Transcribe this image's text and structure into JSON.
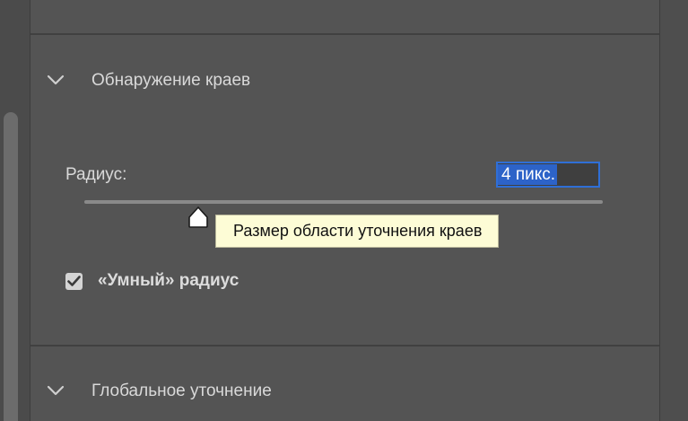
{
  "panel": {
    "sections": [
      {
        "title": "Обнаружение краев",
        "expanded": true,
        "chevron_icon": "chevron-down-icon"
      },
      {
        "title": "Глобальное уточнение",
        "expanded": true,
        "chevron_icon": "chevron-down-icon"
      }
    ]
  },
  "edge_detection": {
    "radius_label": "Радиус:",
    "radius_value": "4 пикс.",
    "slider_value_fraction": 0.22,
    "tooltip": "Размер области уточнения краев",
    "smart_radius": {
      "label": "«Умный» радиус",
      "checked": true
    }
  },
  "colors": {
    "panel_bg": "#545454",
    "selection": "#2d63c8",
    "focus_border": "#2f6fd6",
    "tooltip_bg": "#fdfcd6"
  }
}
